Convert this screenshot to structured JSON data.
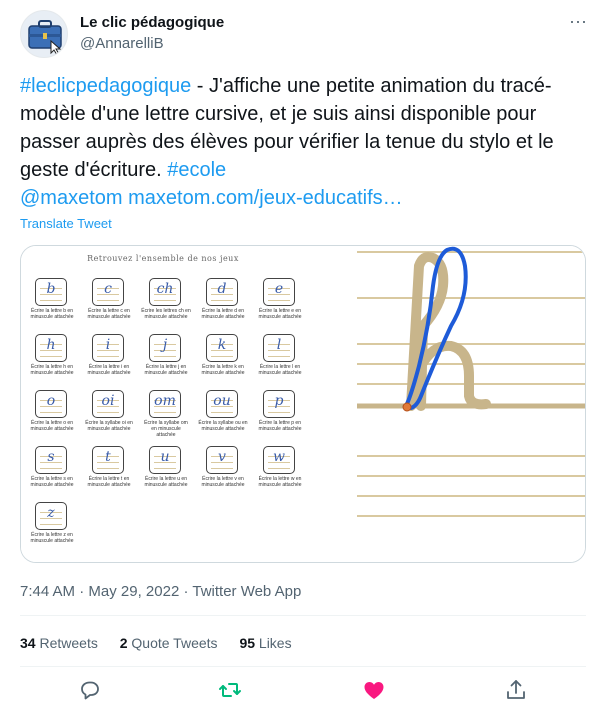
{
  "author": {
    "name": "Le clic pédagogique",
    "handle": "@AnnarelliB"
  },
  "more_icon": "more-horizontal-icon",
  "tweet": {
    "hashtag1": "#leclicpedagogique",
    "text1": " - J'affiche une petite animation du tracé-modèle d'une lettre cursive, et je suis ainsi disponible pour passer auprès des élèves pour vérifier la tenue du stylo et le geste d'écriture. ",
    "hashtag2": "#ecole",
    "mention": "@maxetom",
    "link": "maxetom.com/jeux-educatifs…"
  },
  "translate_label": "Translate Tweet",
  "media": {
    "grid_title": "Retrouvez l'ensemble de nos jeux",
    "tiles": [
      {
        "glyph": "b",
        "caption": "Écrire la lettre b en minuscule attachée"
      },
      {
        "glyph": "c",
        "caption": "Écrire la lettre c en minuscule attachée"
      },
      {
        "glyph": "ch",
        "caption": "Écrire les lettres ch en minuscule attachée"
      },
      {
        "glyph": "d",
        "caption": "Écrire la lettre d en minuscule attachée"
      },
      {
        "glyph": "e",
        "caption": "Écrire la lettre e en minuscule attachée"
      },
      {
        "glyph": "h",
        "caption": "Écrire la lettre h en minuscule attachée"
      },
      {
        "glyph": "i",
        "caption": "Écrire la lettre i en minuscule attachée"
      },
      {
        "glyph": "j",
        "caption": "Écrire la lettre j en minuscule attachée"
      },
      {
        "glyph": "k",
        "caption": "Écrire la lettre k en minuscule attachée"
      },
      {
        "glyph": "l",
        "caption": "Écrire la lettre l en minuscule attachée"
      },
      {
        "glyph": "o",
        "caption": "Écrire la lettre o en minuscule attachée"
      },
      {
        "glyph": "oi",
        "caption": "Écrire la syllabe oi en minuscule attachée"
      },
      {
        "glyph": "om",
        "caption": "Écrire la syllabe om en minuscule attachée"
      },
      {
        "glyph": "ou",
        "caption": "Écrire la syllabe ou en minuscule attachée"
      },
      {
        "glyph": "p",
        "caption": "Écrire la lettre p en minuscule attachée"
      },
      {
        "glyph": "s",
        "caption": "Écrire la lettre s en minuscule attachée"
      },
      {
        "glyph": "t",
        "caption": "Écrire la lettre t en minuscule attachée"
      },
      {
        "glyph": "u",
        "caption": "Écrire la lettre u en minuscule attachée"
      },
      {
        "glyph": "v",
        "caption": "Écrire la lettre v en minuscule attachée"
      },
      {
        "glyph": "w",
        "caption": "Écrire la lettre w en minuscule attachée"
      },
      {
        "glyph": "z",
        "caption": "Écrire la lettre z en minuscule attachée"
      }
    ],
    "big_letter": "h"
  },
  "meta": {
    "time": "7:44 AM",
    "sep": " · ",
    "date": "May 29, 2022",
    "client": "Twitter Web App"
  },
  "stats": {
    "retweets_count": "34",
    "retweets_label": "Retweets",
    "quotes_count": "2",
    "quotes_label": "Quote Tweets",
    "likes_count": "95",
    "likes_label": "Likes"
  },
  "actions": {
    "reply_icon": "reply-icon",
    "retweet_icon": "retweet-icon",
    "like_icon": "heart-icon",
    "share_icon": "share-icon",
    "retweet_color": "#00ba7c",
    "like_color": "#f91880"
  }
}
